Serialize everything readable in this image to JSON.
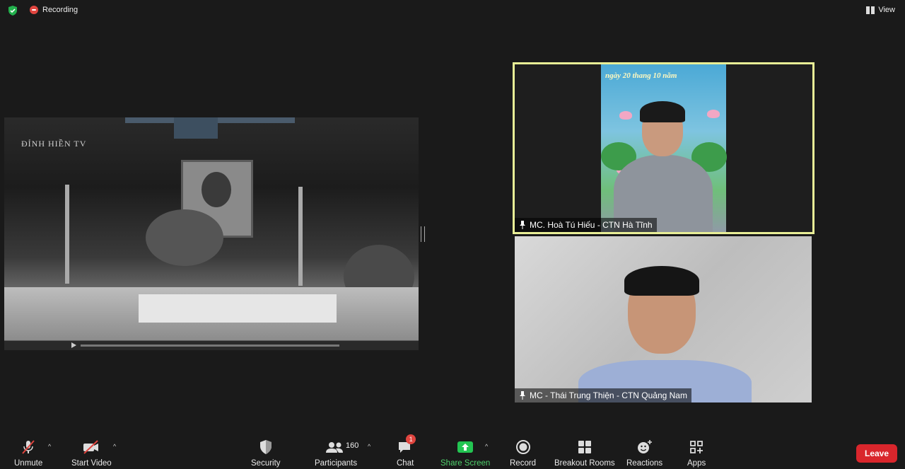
{
  "topbar": {
    "recording_label": "Recording",
    "view_label": "View"
  },
  "shared_screen": {
    "watermark": "ĐỈNH HIỀN TV"
  },
  "participants": [
    {
      "name": "MC. Hoà Tú Hiếu - CTN Hà Tĩnh",
      "background_text": "ngày 20 thang 10 năm"
    },
    {
      "name": "MC - Thái Trung Thiện - CTN Quảng Nam"
    }
  ],
  "toolbar": {
    "unmute": "Unmute",
    "start_video": "Start Video",
    "security": "Security",
    "participants": "Participants",
    "participants_count": "160",
    "chat": "Chat",
    "chat_badge": "1",
    "share_screen": "Share Screen",
    "record": "Record",
    "breakout_rooms": "Breakout Rooms",
    "reactions": "Reactions",
    "apps": "Apps",
    "leave": "Leave"
  },
  "colors": {
    "active_speaker_border": "#e8ee96",
    "share_green": "#4fd06b",
    "leave_red": "#d9262c",
    "recording_red": "#e0453f"
  }
}
